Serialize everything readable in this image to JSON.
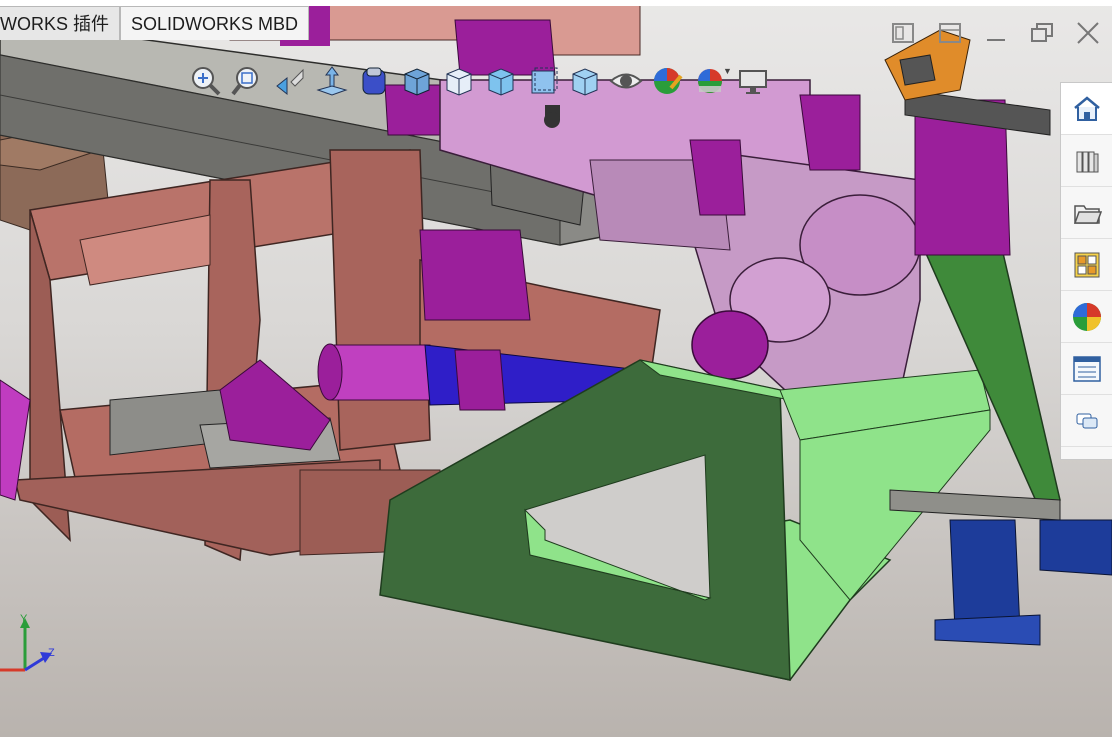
{
  "tabs": [
    {
      "label": "WORKS 插件"
    },
    {
      "label": "SOLIDWORKS MBD"
    }
  ],
  "heads_up_toolbar": [
    {
      "icon": "zoom-to-fit-icon"
    },
    {
      "icon": "zoom-to-area-icon"
    },
    {
      "icon": "previous-view-icon"
    },
    {
      "icon": "section-view-icon"
    },
    {
      "icon": "dynamic-annotation-views-icon"
    },
    {
      "icon": "view-orientation-icon"
    },
    {
      "icon": "display-style-icon"
    },
    {
      "icon": "hide-show-items-icon"
    },
    {
      "icon": "edit-appearance-icon"
    },
    {
      "icon": "apply-scene-icon"
    },
    {
      "icon": "view-settings-icon"
    }
  ],
  "window_controls": [
    {
      "icon": "restore-pane-icon"
    },
    {
      "icon": "split-pane-icon"
    },
    {
      "icon": "minimize-icon"
    },
    {
      "icon": "restore-icon"
    },
    {
      "icon": "close-icon"
    }
  ],
  "task_pane": [
    {
      "icon": "solidworks-resources-icon",
      "active": true
    },
    {
      "icon": "design-library-icon"
    },
    {
      "icon": "file-explorer-icon"
    },
    {
      "icon": "view-palette-icon"
    },
    {
      "icon": "appearances-scenes-icon"
    },
    {
      "icon": "custom-properties-icon"
    },
    {
      "icon": "solidworks-forum-icon"
    }
  ],
  "triad": {
    "x_label": "",
    "y_label": "Y",
    "z_label": "Z"
  },
  "colors": {
    "frame_brown": "#a8645c",
    "frame_green": "#3d6b3b",
    "frame_light_green": "#8fe38a",
    "magenta": "#9b1f9b",
    "pink": "#c68ec6",
    "grey_beam": "#7c7c78",
    "cylinder_blue": "#2f1ec8",
    "base_blue": "#1d3c9a"
  }
}
